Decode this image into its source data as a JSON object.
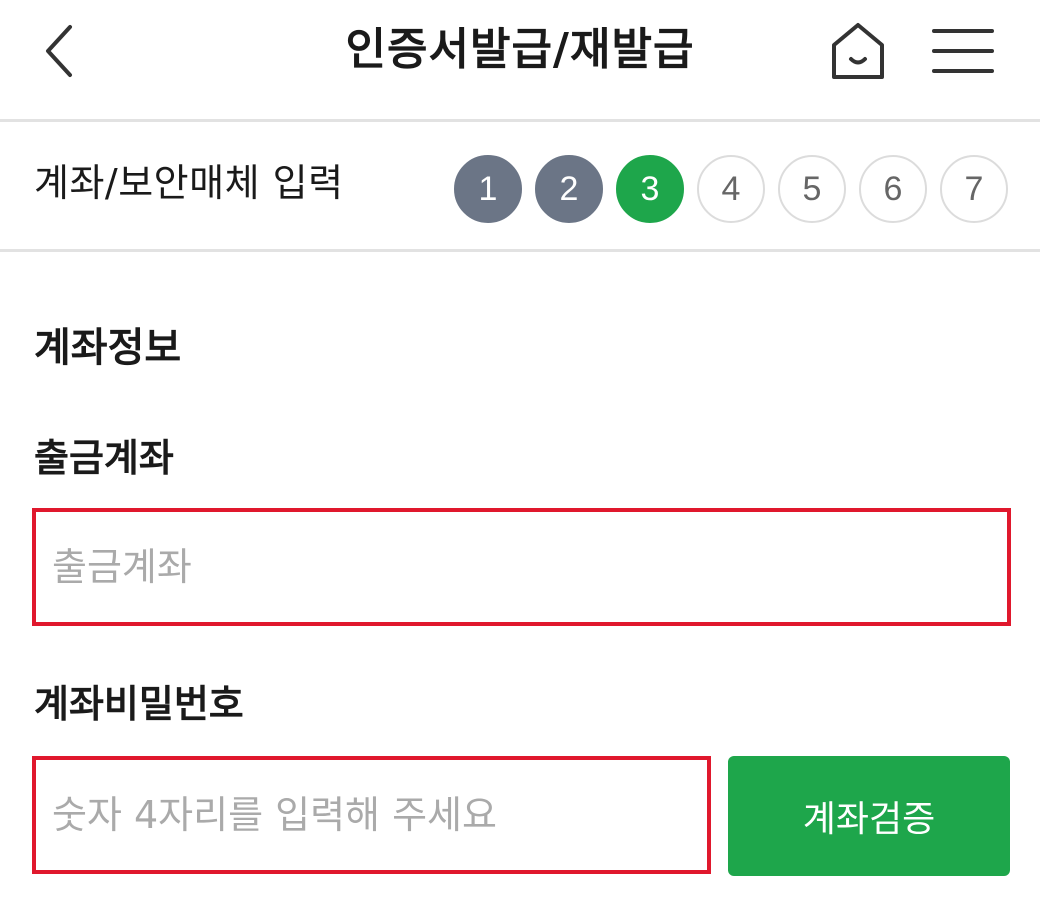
{
  "header": {
    "title": "인증서발급/재발급",
    "back_icon": "chevron-left-icon",
    "home_icon": "home-icon",
    "menu_icon": "hamburger-menu-icon"
  },
  "stepbar": {
    "title": "계좌/보안매체 입력",
    "steps": [
      "1",
      "2",
      "3",
      "4",
      "5",
      "6",
      "7"
    ],
    "current_step": 3,
    "colors": {
      "done": "#6b7586",
      "current": "#1ea64b",
      "pending_border": "#dcdcdc"
    }
  },
  "account_info": {
    "section_title": "계좌정보",
    "withdrawal_account": {
      "label": "출금계좌",
      "placeholder": "출금계좌",
      "value": ""
    },
    "account_password": {
      "label": "계좌비밀번호",
      "placeholder": "숫자 4자리를 입력해 주세요",
      "value": ""
    },
    "verify_button_label": "계좌검증"
  },
  "colors": {
    "accent": "#1ea64b",
    "error_border": "#e0182d"
  }
}
